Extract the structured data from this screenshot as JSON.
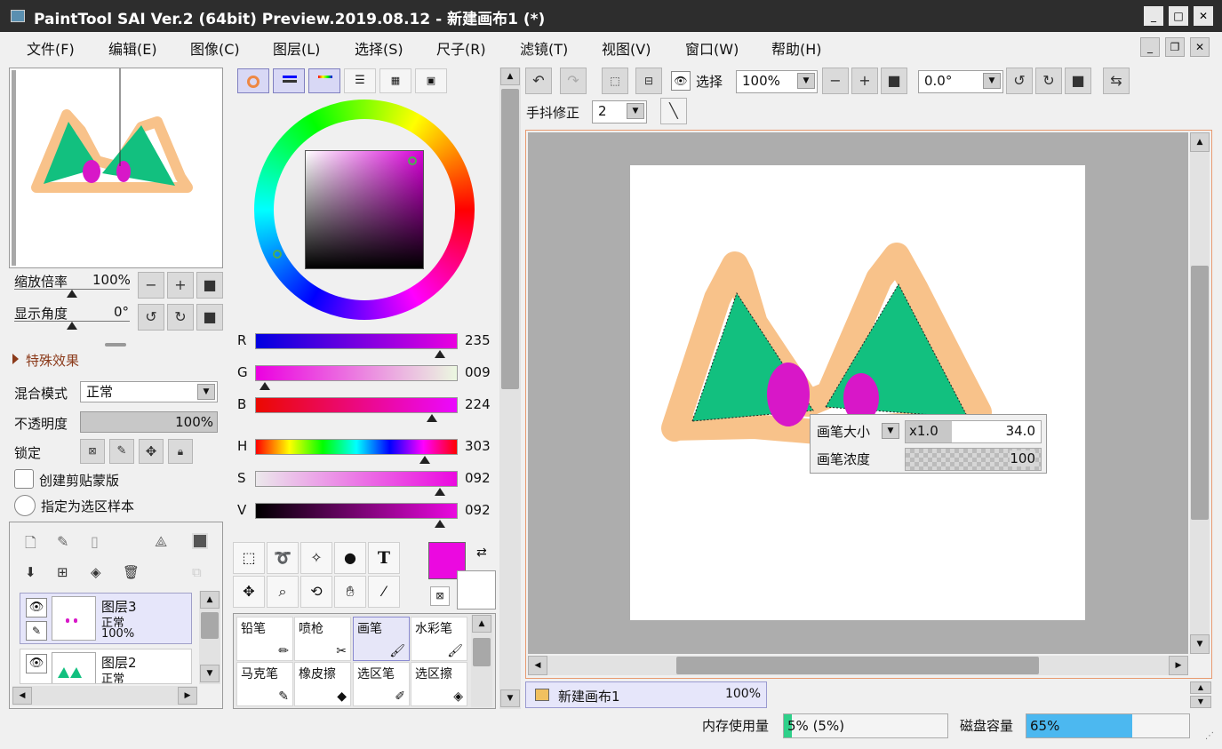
{
  "window": {
    "title": "PaintTool SAI Ver.2 (64bit) Preview.2019.08.12 - 新建画布1 (*)"
  },
  "menu": [
    "文件(F)",
    "编辑(E)",
    "图像(C)",
    "图层(L)",
    "选择(S)",
    "尺子(R)",
    "滤镜(T)",
    "视图(V)",
    "窗口(W)",
    "帮助(H)"
  ],
  "navigator": {
    "zoom_label": "缩放倍率",
    "zoom_value": "100%",
    "angle_label": "显示角度",
    "angle_value": "0°"
  },
  "effects": {
    "label": "特殊效果"
  },
  "layer_props": {
    "blend_label": "混合模式",
    "blend_value": "正常",
    "opacity_label": "不透明度",
    "opacity_value": "100%",
    "lock_label": "锁定",
    "clip_label": "创建剪贴蒙版",
    "sample_label": "指定为选区样本"
  },
  "layers": [
    {
      "name": "图层3",
      "mode": "正常",
      "opacity": "100%"
    },
    {
      "name": "图层2",
      "mode": "正常",
      "opacity": ""
    }
  ],
  "color": {
    "R": "235",
    "G": "009",
    "B": "224",
    "H": "303",
    "S": "092",
    "V": "092",
    "labels": {
      "R": "R",
      "G": "G",
      "B": "B",
      "H": "H",
      "S": "S",
      "V": "V"
    },
    "current": "#eb09e0",
    "secondary": "#ffffff"
  },
  "brushes": [
    "铅笔",
    "喷枪",
    "画笔",
    "水彩笔",
    "马克笔",
    "橡皮擦",
    "选区笔",
    "选区擦"
  ],
  "toolbar": {
    "select_label": "选择",
    "zoom_value": "100%",
    "angle_value": "0.0°",
    "stabilizer_label": "手抖修正",
    "stabilizer_value": "2"
  },
  "brush_popup": {
    "size_label": "画笔大小",
    "size_mult": "x1.0",
    "size_value": "34.0",
    "density_label": "画笔浓度",
    "density_value": "100"
  },
  "canvas_tab": {
    "name": "新建画布1",
    "zoom": "100%"
  },
  "status": {
    "memory_label": "内存使用量",
    "memory_value": "5% (5%)",
    "memory_fraction": 0.05,
    "disk_label": "磁盘容量",
    "disk_value": "65%",
    "disk_fraction": 0.65
  }
}
